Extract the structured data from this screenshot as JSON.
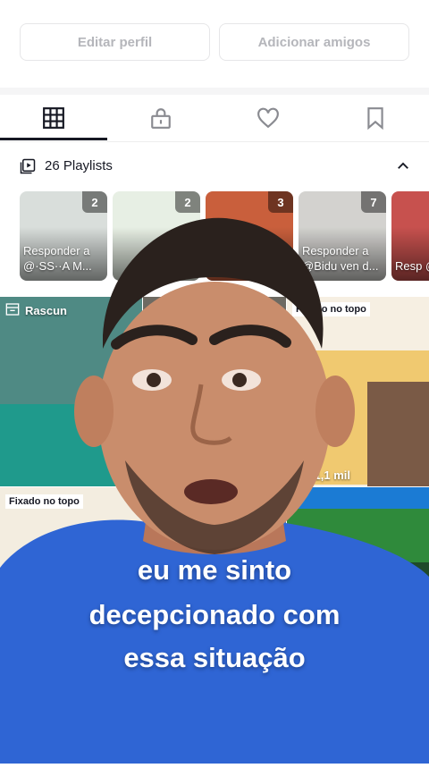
{
  "profile": {
    "edit_label": "Editar perfil",
    "add_friends_label": "Adicionar amigos"
  },
  "tabs": [
    {
      "icon": "grid-icon"
    },
    {
      "icon": "lock-icon"
    },
    {
      "icon": "heart-icon"
    },
    {
      "icon": "bookmark-icon"
    }
  ],
  "playlists": {
    "title": "26 Playlists",
    "items": [
      {
        "count": "2",
        "text": "Responder a @·SS··A M..."
      },
      {
        "count": "2",
        "text": ""
      },
      {
        "count": "3",
        "text": ""
      },
      {
        "count": "7",
        "text": "Responder a @Bidu ven d..."
      },
      {
        "count": "",
        "text": "Resp @Edn"
      }
    ]
  },
  "grid": {
    "draft_label": "Rascun",
    "pinned_label": "Fixado no topo",
    "pinned_label_2": "Fixado no topo",
    "views": "11,1 mil"
  },
  "captions": {
    "line1": "eu me sinto",
    "line2": "decepcionado com",
    "line3": "essa situação"
  },
  "colors": {
    "accent_text": "#161823",
    "skin": "#c98d6c",
    "shirt": "#2f65d4"
  }
}
